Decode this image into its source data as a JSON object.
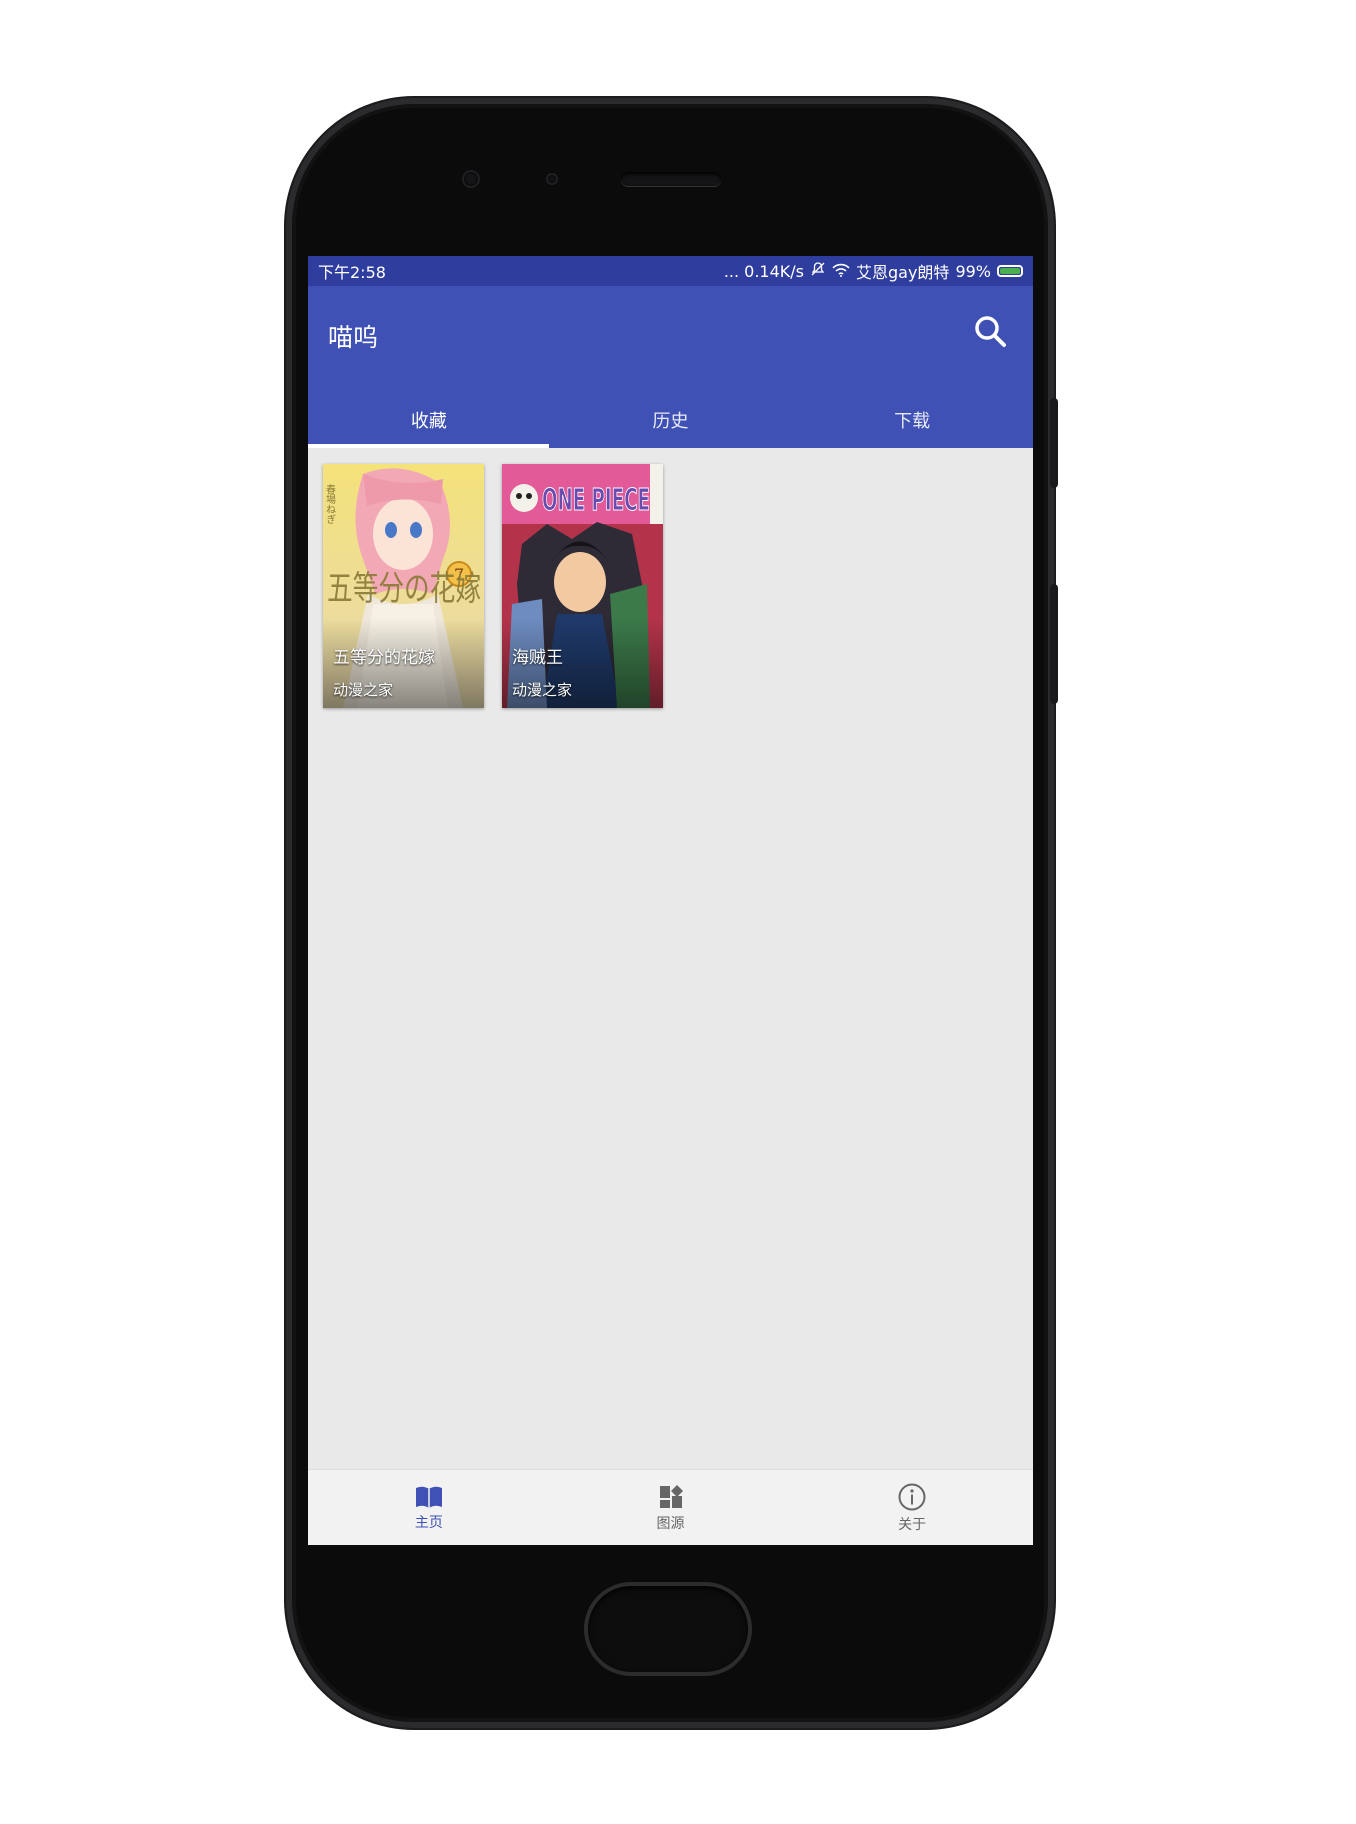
{
  "colors": {
    "primary": "#3f51b5",
    "primary_dark": "#2f3e9e",
    "background": "#e9e9e9",
    "nav_inactive": "#666666"
  },
  "status_bar": {
    "time": "下午2:58",
    "right_text": "... 0.14K/s",
    "carrier": "艾恩gay朗特",
    "battery": "99%"
  },
  "app_bar": {
    "title": "喵呜",
    "search_icon": "search-icon"
  },
  "tabs": [
    {
      "label": "收藏",
      "active": true
    },
    {
      "label": "历史",
      "active": false
    },
    {
      "label": "下载",
      "active": false
    }
  ],
  "favorites": [
    {
      "title": "五等分的花嫁",
      "source": "动漫之家",
      "cover_text": "五等分の花嫁",
      "volume": "7",
      "author": "春場ねぎ"
    },
    {
      "title": "海贼王",
      "source": "动漫之家",
      "cover_text": "ONE PIECE"
    }
  ],
  "bottom_nav": [
    {
      "label": "主页",
      "icon": "book-icon",
      "active": true
    },
    {
      "label": "图源",
      "icon": "dashboard-icon",
      "active": false
    },
    {
      "label": "关于",
      "icon": "info-icon",
      "active": false
    }
  ]
}
